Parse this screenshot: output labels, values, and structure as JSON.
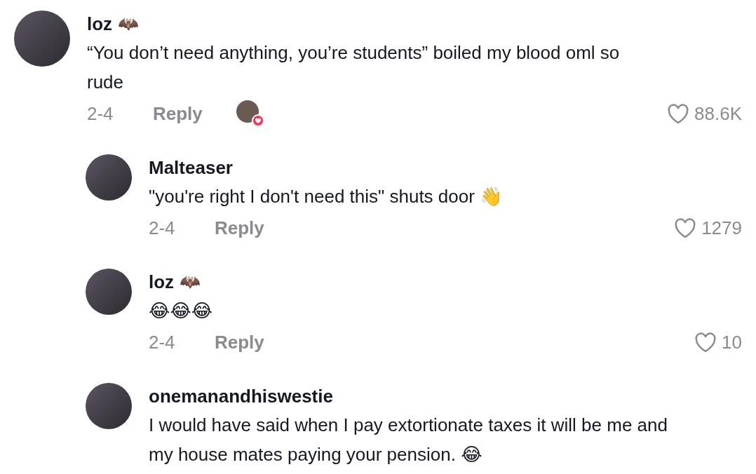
{
  "comments": [
    {
      "author": "loz",
      "author_badge": "🦇",
      "text": "“You don’t need anything, you’re students” boiled my blood oml so rude",
      "date": "2-4",
      "reply_label": "Reply",
      "liked_by_creator": true,
      "likes": "88.6K",
      "replies": [
        {
          "author": "Malteaser",
          "text": "\"you're right I don't need this\" shuts door 👋",
          "date": "2-4",
          "reply_label": "Reply",
          "likes": "1279"
        },
        {
          "author": "loz",
          "author_badge": "🦇",
          "text": "😂😂😂",
          "date": "2-4",
          "reply_label": "Reply",
          "likes": "10"
        },
        {
          "author": "onemanandhiswestie",
          "text": "I would have said when I pay extortionate taxes it will be me and my house mates paying your pension. 😂"
        }
      ]
    }
  ]
}
